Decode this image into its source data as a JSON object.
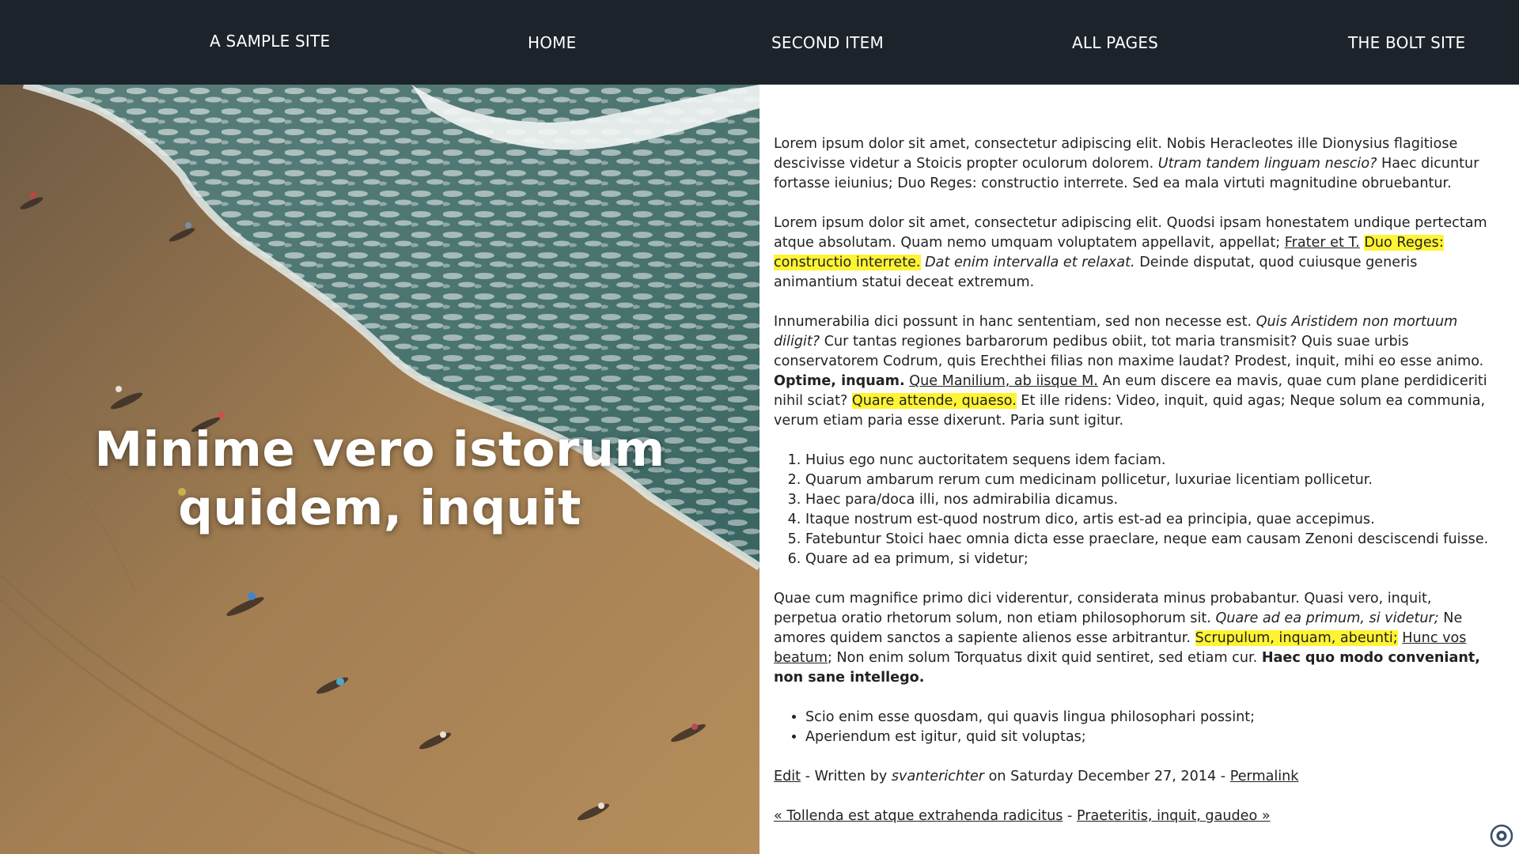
{
  "nav": {
    "brand": "A SAMPLE SITE",
    "items": [
      {
        "label": "HOME"
      },
      {
        "label": "SECOND ITEM"
      },
      {
        "label": "ALL PAGES"
      },
      {
        "label": "THE BOLT SITE"
      }
    ]
  },
  "hero": {
    "title": "Minime vero istorum quidem, inquit"
  },
  "article": {
    "p1": {
      "a": "Lorem ipsum dolor sit amet, consectetur adipiscing elit. Nobis Heracleotes ille Dionysius flagitiose descivisse videtur a Stoicis propter oculorum dolorem. ",
      "em": "Utram tandem linguam nescio?",
      "b": " Haec dicuntur fortasse ieiunius; Duo Reges: constructio interrete. Sed ea mala virtuti magnitudine obruebantur."
    },
    "p2": {
      "a": "Lorem ipsum dolor sit amet, consectetur adipiscing elit. Quodsi ipsam honestatem undique pertectam atque absolutam. Quam nemo umquam voluptatem appellavit, appellat; ",
      "link": "Frater et T.",
      "sp": " ",
      "mark": "Duo Reges: constructio interrete.",
      "sp2": " ",
      "em": "Dat enim intervalla et relaxat.",
      "b": " Deinde disputat, quod cuiusque generis animantium statui deceat extremum."
    },
    "p3": {
      "a": "Innumerabilia dici possunt in hanc sententiam, sed non necesse est. ",
      "em": "Quis Aristidem non mortuum diligit?",
      "b": " Cur tantas regiones barbarorum pedibus obiit, tot maria transmisit? Quis suae urbis conservatorem Codrum, quis Erechthei filias non maxime laudat? Prodest, inquit, mihi eo esse animo. ",
      "strong": "Optime, inquam.",
      "sp": " ",
      "link": "Que Manilium, ab iisque M.",
      "c": " An eum discere ea mavis, quae cum plane perdidiceriti nihil sciat? ",
      "mark": "Quare attende, quaeso.",
      "d": " Et ille ridens: Video, inquit, quid agas; Neque solum ea communia, verum etiam paria esse dixerunt. Paria sunt igitur."
    },
    "ordered_list": [
      "Huius ego nunc auctoritatem sequens idem faciam.",
      "Quarum ambarum rerum cum medicinam pollicetur, luxuriae licentiam pollicetur.",
      "Haec para/doca illi, nos admirabilia dicamus.",
      "Itaque nostrum est-quod nostrum dico, artis est-ad ea principia, quae accepimus.",
      "Fatebuntur Stoici haec omnia dicta esse praeclare, neque eam causam Zenoni desciscendi fuisse.",
      "Quare ad ea primum, si videtur;"
    ],
    "p4": {
      "a": "Quae cum magnifice primo dici viderentur, considerata minus probabantur. Quasi vero, inquit, perpetua oratio rhetorum solum, non etiam philosophorum sit. ",
      "em": "Quare ad ea primum, si videtur;",
      "b": " Ne amores quidem sanctos a sapiente alienos esse arbitrantur. ",
      "mark": "Scrupulum, inquam, abeunti;",
      "sp": " ",
      "link": "Hunc vos beatum",
      "c": "; Non enim solum Torquatus dixit quid sentiret, sed etiam cur. ",
      "strong": "Haec quo modo conveniant, non sane intellego."
    },
    "bullet_list": [
      "Scio enim esse quosdam, qui quavis lingua philosophari possint;",
      "Aperiendum est igitur, quid sit voluptas;"
    ],
    "meta": {
      "edit": "Edit",
      "written_by": " - Written by ",
      "author": "svanterichter",
      "on": " on Saturday December 27, 2014 - ",
      "permalink": "Permalink"
    },
    "pager": {
      "prev": "« Tollenda est atque extrahenda radicitus",
      "sep": " - ",
      "next": "Praeteritis, inquit, gaudeo »"
    }
  },
  "colors": {
    "nav_bg": "#1d232b",
    "highlight": "#fff433",
    "sand": "#a78356",
    "sea": "#3f6f6a"
  }
}
